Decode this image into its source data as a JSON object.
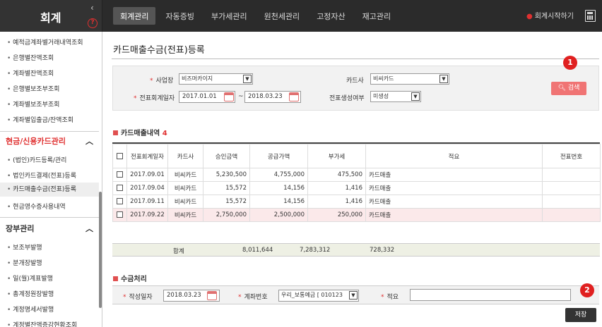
{
  "app": {
    "title": "회계"
  },
  "nav": {
    "tabs": [
      "회계관리",
      "자동증빙",
      "부가세관리",
      "원천세관리",
      "고정자산",
      "재고관리"
    ],
    "active": 0,
    "start_label": "회계시작하기"
  },
  "sidebar": {
    "items_top": [
      "예적금계좌별거래내역조회",
      "은행별잔액조회",
      "계좌별잔액조회",
      "은행별보조부조회",
      "계좌별보조부조회",
      "계좌별입출금/잔액조회"
    ],
    "section1": "현금/신용카드관리",
    "items_card": [
      "(법인)카드등록/관리",
      "법인카드결제(전표)등록",
      "카드매출수금(전표)등록",
      "현금영수증사용내역"
    ],
    "section2": "장부관리",
    "items_ledger": [
      "보조부발행",
      "분개장발행",
      "일(월)계표발행",
      "총계정원장발행",
      "계정명세서발행",
      "계정별잔액증감현황조회"
    ]
  },
  "page": {
    "title": "카드매출수금(전표)등록"
  },
  "search": {
    "business_label": "사업장",
    "business_value": "비즈머카이지",
    "date_label": "전표회계일자",
    "date_from": "2017.01.01",
    "date_sep": "~",
    "date_to": "2018.03.23",
    "card_label": "카드사",
    "card_value": "비씨카드",
    "voucher_label": "전표생성여부",
    "voucher_value": "미생성",
    "search_button": "검색"
  },
  "badges": {
    "one": "1",
    "two": "2"
  },
  "list": {
    "title": "카드매출내역",
    "count": "4",
    "headers": [
      "전표회계일자",
      "카드사",
      "승인금액",
      "공급가액",
      "부가세",
      "적요",
      "전표번호"
    ],
    "rows": [
      {
        "date": "2017.09.01",
        "card": "비씨카드",
        "approved": "5,230,500",
        "supply": "4,755,000",
        "vat": "475,500",
        "memo": "카드매출",
        "voucher": ""
      },
      {
        "date": "2017.09.04",
        "card": "비씨카드",
        "approved": "15,572",
        "supply": "14,156",
        "vat": "1,416",
        "memo": "카드매출",
        "voucher": ""
      },
      {
        "date": "2017.09.11",
        "card": "비씨카드",
        "approved": "15,572",
        "supply": "14,156",
        "vat": "1,416",
        "memo": "카드매출",
        "voucher": ""
      },
      {
        "date": "2017.09.22",
        "card": "비씨카드",
        "approved": "2,750,000",
        "supply": "2,500,000",
        "vat": "250,000",
        "memo": "카드매출",
        "voucher": ""
      }
    ],
    "total_label": "합계",
    "total_approved": "8,011,644",
    "total_supply": "7,283,312",
    "total_vat": "728,332"
  },
  "receipt": {
    "title": "수금처리",
    "date_label": "작성일자",
    "date_value": "2018.03.23",
    "account_label": "계좌번호",
    "account_value": "우리_보통예금 [ 010123",
    "memo_label": "적요",
    "memo_value": "",
    "save_button": "저장"
  },
  "colors": {
    "accent": "#e03030",
    "search_button": "#f07474",
    "topbar": "#2b2b2b"
  }
}
